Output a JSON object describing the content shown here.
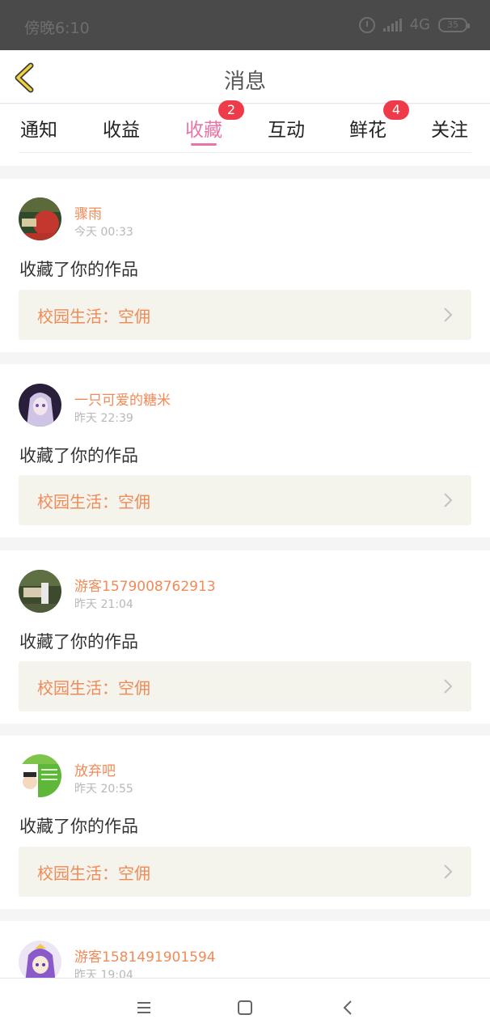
{
  "status_bar": {
    "time": "傍晚6:10",
    "network": "4G",
    "battery": "35",
    "icons": [
      "alarm-icon",
      "signal-icon",
      "battery-icon"
    ]
  },
  "header": {
    "title": "消息",
    "back_icon": "chevron-left-icon"
  },
  "tabs": [
    {
      "label": "通知",
      "badge": null
    },
    {
      "label": "收益",
      "badge": null
    },
    {
      "label": "收藏",
      "badge": "2",
      "active": true
    },
    {
      "label": "互动",
      "badge": null
    },
    {
      "label": "鲜花",
      "badge": "4"
    },
    {
      "label": "关注",
      "badge": null
    }
  ],
  "messages": [
    {
      "user": "骤雨",
      "time": "今天 00:33",
      "action": "收藏了你的作品",
      "work_title": "校园生活：空佣"
    },
    {
      "user": "一只可爱的糖米",
      "time": "昨天 22:39",
      "action": "收藏了你的作品",
      "work_title": "校园生活：空佣"
    },
    {
      "user": "游客1579008762913",
      "time": "昨天 21:04",
      "action": "收藏了你的作品",
      "work_title": "校园生活：空佣"
    },
    {
      "user": "放弃吧",
      "time": "昨天 20:55",
      "action": "收藏了你的作品",
      "work_title": "校园生活：空佣"
    },
    {
      "user": "游客1581491901594",
      "time": "昨天 19:04",
      "action": "",
      "work_title": ""
    }
  ],
  "nav_bar": {
    "icons": [
      "menu-icon",
      "home-square-icon",
      "back-triangle-icon"
    ]
  },
  "colors": {
    "accent_pink": "#e776a6",
    "name_orange": "#f08a57",
    "badge_red": "#ef3a4a",
    "work_bg": "#f4f3ec"
  }
}
